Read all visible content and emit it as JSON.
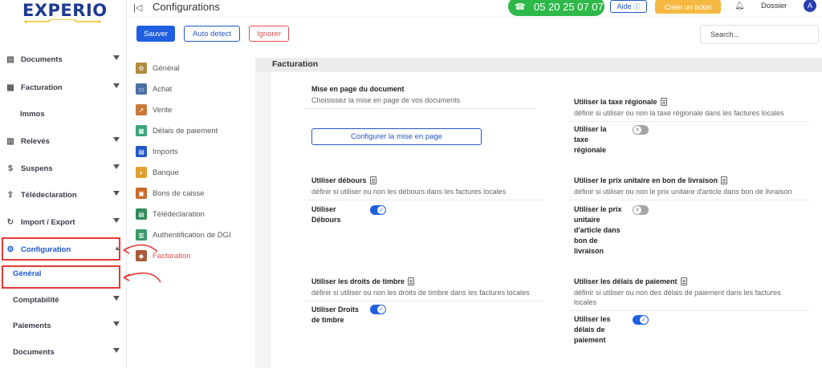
{
  "app": {
    "logo": "EXPERIO"
  },
  "sidebar": {
    "items": [
      {
        "label": "Documents",
        "icon": "documents-icon"
      },
      {
        "label": "Facturation",
        "icon": "invoice-icon"
      },
      {
        "label": "Immos"
      },
      {
        "label": "Relevés",
        "icon": "chart-icon"
      },
      {
        "label": "Suspens",
        "icon": "suspense-icon"
      },
      {
        "label": "Télédeclaration",
        "icon": "upload-icon"
      },
      {
        "label": "Import / Export",
        "icon": "history-icon"
      },
      {
        "label": "Configuration",
        "icon": "gear-icon"
      },
      {
        "label": "Général"
      },
      {
        "label": "Comptabilité"
      },
      {
        "label": "Paiements"
      },
      {
        "label": "Documents"
      }
    ]
  },
  "header": {
    "title": "Configurations",
    "phone": "05 20 25 07 07",
    "aide_label": "Aide",
    "ticket_label": "Créer un ticket",
    "dossier_label": "Dossier",
    "avatar_initial": "A"
  },
  "toolbar": {
    "save_label": "Sauver",
    "detect_label": "Auto detect",
    "ignore_label": "Ignorer",
    "search_placeholder": "Search..."
  },
  "submenu": {
    "items": [
      {
        "label": "Général",
        "color": "#b38a3e"
      },
      {
        "label": "Achat",
        "color": "#4a6fa5"
      },
      {
        "label": "Vente",
        "color": "#c87a3a"
      },
      {
        "label": "Délais de paiement",
        "color": "#3aa57a"
      },
      {
        "label": "Imports",
        "color": "#2456c9"
      },
      {
        "label": "Banque",
        "color": "#e0a030"
      },
      {
        "label": "Bons de caisse",
        "color": "#c86a2a"
      },
      {
        "label": "Télédeclaration",
        "color": "#2e8b57"
      },
      {
        "label": "Authentification de DGI",
        "color": "#3a9a6a"
      },
      {
        "label": "Facturation",
        "color": "#a85a3a"
      }
    ]
  },
  "panel": {
    "title": "Facturation",
    "layout": {
      "title": "Mise en page du document",
      "desc": "Choisissez la mise en page de vos documents",
      "button": "Configurer la mise en page"
    },
    "taxe": {
      "title": "Utiliser la taxe régionale",
      "desc": "définir si utiliser ou non la taxe régionale dans les factures locales",
      "label_1": "Utiliser la",
      "label_2": "taxe",
      "label_3": "régionale",
      "enabled": false
    },
    "debours": {
      "title": "Utiliser débours",
      "desc": "définir si utiliser ou non les débours dans les factures locales",
      "label_1": "Utiliser",
      "label_2": "Débours",
      "enabled": true
    },
    "prix": {
      "title": "Utiliser le prix unitaire en bon de livraison",
      "desc": "définir si utiliser ou non le prix unitaire d'article dans bon de livraison",
      "label_1": "Utiliser le prix",
      "label_2": "unitaire",
      "label_3": "d'article dans",
      "label_4": "bon de",
      "label_5": "livraison",
      "enabled": false
    },
    "timbre": {
      "title": "Utiliser les droits de timbre",
      "desc": "définir si utiliser ou non les droits de timbre dans les factures locales",
      "label_1": "Utiliser Droits",
      "label_2": "de timbre",
      "enabled": true
    },
    "delais": {
      "title": "Utiliser les délais de paiement",
      "desc_1": "définir si utiliser ou non des délais de paiement dans les factures",
      "desc_2": "locales",
      "label_1": "Utiliser les",
      "label_2": "délais de",
      "label_3": "paiement",
      "enabled": true
    }
  },
  "colors": {
    "primary": "#1f5fe0",
    "danger": "#e53935",
    "phone_green": "#2eb84a",
    "ticket_orange": "#f5b942",
    "logo_blue": "#1f3a93"
  }
}
